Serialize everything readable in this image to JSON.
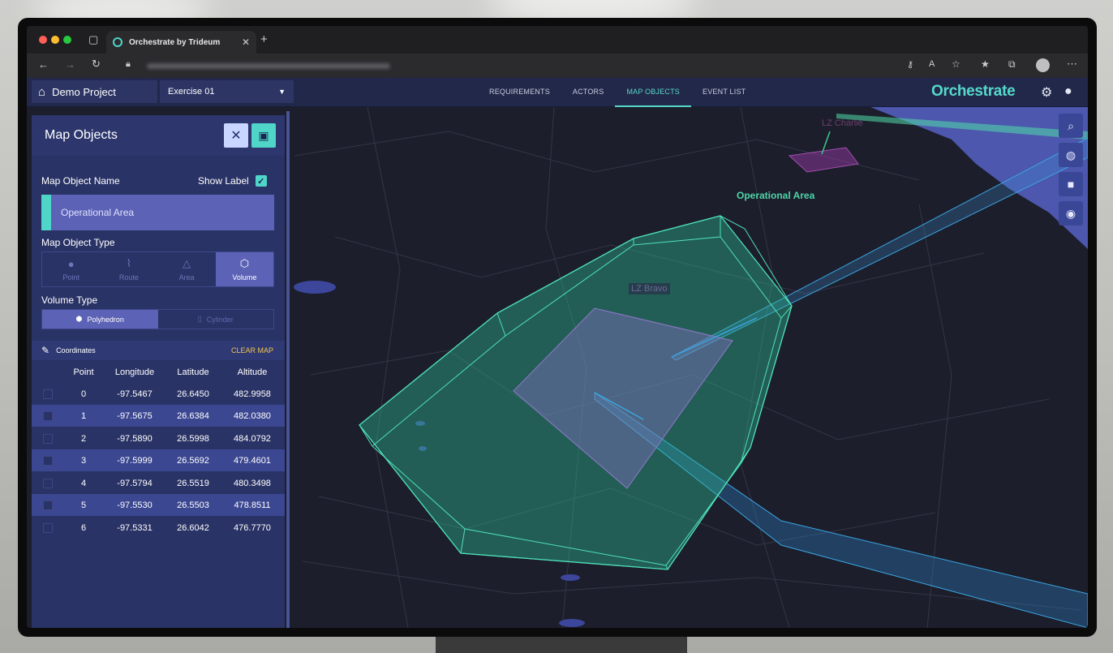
{
  "browser": {
    "tab_title": "Orchestrate by Trideum",
    "url_text": ""
  },
  "header": {
    "project": "Demo Project",
    "exercise": "Exercise 01",
    "nav": [
      "REQUIREMENTS",
      "ACTORS",
      "MAP OBJECTS",
      "EVENT LIST"
    ],
    "active_nav": "MAP OBJECTS",
    "brand": "Orchestrate"
  },
  "panel": {
    "title": "Map Objects",
    "name_label": "Map Object Name",
    "show_label": "Show Label",
    "show_label_checked": true,
    "name_value": "Operational Area",
    "type_label": "Map Object Type",
    "types": [
      {
        "label": "Point",
        "icon": "pin-icon"
      },
      {
        "label": "Route",
        "icon": "route-icon"
      },
      {
        "label": "Area",
        "icon": "area-icon"
      },
      {
        "label": "Volume",
        "icon": "volume-icon"
      }
    ],
    "active_type": "Volume",
    "volume_label": "Volume Type",
    "volume_types": [
      "Polyhedron",
      "Cylinder"
    ],
    "active_volume": "Polyhedron",
    "coordinates_label": "Coordinates",
    "clear_map": "CLEAR MAP",
    "columns": [
      "Point",
      "Longitude",
      "Latitude",
      "Altitude"
    ],
    "rows": [
      [
        "0",
        "-97.5467",
        "26.6450",
        "482.9958"
      ],
      [
        "1",
        "-97.5675",
        "26.6384",
        "482.0380"
      ],
      [
        "2",
        "-97.5890",
        "26.5998",
        "484.0792"
      ],
      [
        "3",
        "-97.5999",
        "26.5692",
        "479.4601"
      ],
      [
        "4",
        "-97.5794",
        "26.5519",
        "480.3498"
      ],
      [
        "5",
        "-97.5530",
        "26.5503",
        "478.8511"
      ],
      [
        "6",
        "-97.5331",
        "26.6042",
        "476.7770"
      ]
    ]
  },
  "map": {
    "labels": {
      "operational_area": "Operational Area",
      "lz_bravo": "LZ Bravo",
      "lz_charlie": "LZ Charlie"
    },
    "tools": [
      "search-icon",
      "globe-icon",
      "camera-icon",
      "eye-icon"
    ]
  },
  "colors": {
    "accent": "#4fd6c8",
    "panel": "#2a3366",
    "header": "#222849",
    "map_bg": "#1c1e2c",
    "clear_map": "#f0c44a"
  }
}
